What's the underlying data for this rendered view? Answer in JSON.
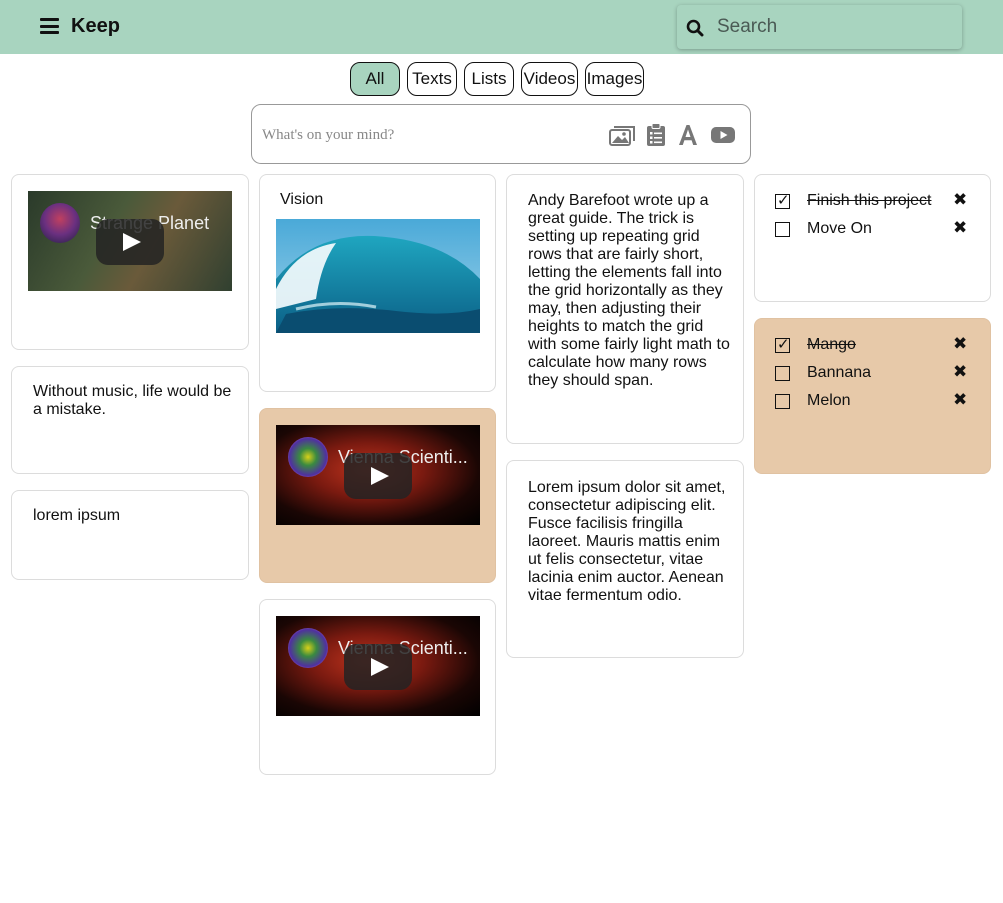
{
  "header": {
    "title": "Keep",
    "menu_icon": "hamburger-menu-icon",
    "search_icon": "search-icon",
    "search_placeholder": "Search"
  },
  "filters": [
    {
      "label": "All",
      "active": true
    },
    {
      "label": "Texts",
      "active": false
    },
    {
      "label": "Lists",
      "active": false
    },
    {
      "label": "Videos",
      "active": false
    },
    {
      "label": "Images",
      "active": false
    }
  ],
  "composer": {
    "placeholder": "What's on your mind?",
    "icons": [
      "image-icon",
      "clipboard-list-icon",
      "text-font-icon",
      "youtube-icon"
    ]
  },
  "notes": {
    "video_strange_planet": {
      "video_title": "Strange Planet"
    },
    "text_music": {
      "text": "Without music, life would be a mistake."
    },
    "text_lorem_short": {
      "text": "lorem ipsum"
    },
    "image_vision": {
      "title": "Vision"
    },
    "video_vienna_1": {
      "video_title": "Vienna Scienti..."
    },
    "video_vienna_2": {
      "video_title": "Vienna Scienti..."
    },
    "text_grid": {
      "text": "Andy Barefoot wrote up a great guide. The trick is setting up repeating grid rows that are fairly short, letting the elements fall into the grid horizontally as they may, then adjusting their heights to match the grid with some fairly light math to calculate how many rows they should span."
    },
    "text_lorem_long": {
      "text": "Lorem ipsum dolor sit amet, consectetur adipiscing elit. Fusce facilisis fringilla laoreet. Mauris mattis enim ut felis consectetur, vitae lacinia enim auctor. Aenean vitae fermentum odio."
    },
    "list_project": {
      "items": [
        {
          "label": "Finish this project",
          "checked": true
        },
        {
          "label": "Move On",
          "checked": false
        }
      ]
    },
    "list_fruit": {
      "items": [
        {
          "label": "Mango",
          "checked": true
        },
        {
          "label": "Bannana",
          "checked": false
        },
        {
          "label": "Melon",
          "checked": false
        }
      ]
    }
  },
  "colors": {
    "accent": "#a8d4bf",
    "note_tan": "#e7c9a9",
    "card_border": "#dcdcdc"
  }
}
